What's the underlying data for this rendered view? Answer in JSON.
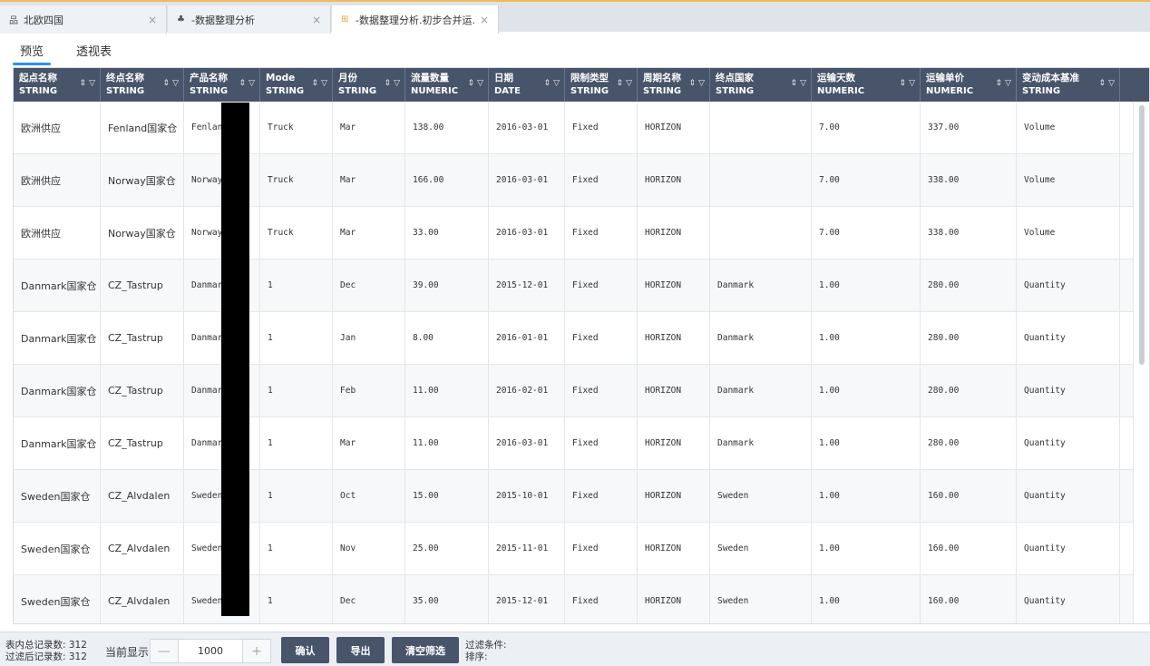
{
  "tabs": [
    {
      "icon": "hierarchy-icon",
      "glyph": "品",
      "label": "北欧四国",
      "close": "×"
    },
    {
      "icon": "cluster-icon",
      "glyph": "♣",
      "label": "-数据整理分析",
      "close": "×"
    },
    {
      "icon": "table-icon",
      "glyph": "⊞",
      "label": "-数据整理分析.初步合并运...",
      "close": "×"
    }
  ],
  "subtabs": {
    "preview": "预览",
    "pivot": "透视表"
  },
  "columns": [
    {
      "name": "起点名称",
      "type": "STRING"
    },
    {
      "name": "终点名称",
      "type": "STRING"
    },
    {
      "name": "产品名称",
      "type": "STRING"
    },
    {
      "name": "Mode",
      "type": "STRING"
    },
    {
      "name": "月份",
      "type": "STRING"
    },
    {
      "name": "流量数量",
      "type": "NUMERIC"
    },
    {
      "name": "日期",
      "type": "DATE"
    },
    {
      "name": "限制类型",
      "type": "STRING"
    },
    {
      "name": "周期名称",
      "type": "STRING"
    },
    {
      "name": "终点国家",
      "type": "STRING"
    },
    {
      "name": "运输天数",
      "type": "NUMERIC"
    },
    {
      "name": "运输单价",
      "type": "NUMERIC"
    },
    {
      "name": "变动成本基准",
      "type": "STRING"
    }
  ],
  "header_icons": {
    "sort": "⇕",
    "filter": "▽"
  },
  "rows": [
    [
      "欧洲供应",
      "Fenland国家仓",
      "Fenland",
      "Truck",
      "Mar",
      "138.00",
      "2016-03-01",
      "Fixed",
      "HORIZON",
      "",
      "7.00",
      "337.00",
      "Volume"
    ],
    [
      "欧洲供应",
      "Norway国家仓",
      "Norway_",
      "Truck",
      "Mar",
      "166.00",
      "2016-03-01",
      "Fixed",
      "HORIZON",
      "",
      "7.00",
      "338.00",
      "Volume"
    ],
    [
      "欧洲供应",
      "Norway国家仓",
      "Norway_",
      "Truck",
      "Mar",
      "33.00",
      "2016-03-01",
      "Fixed",
      "HORIZON",
      "",
      "7.00",
      "338.00",
      "Volume"
    ],
    [
      "Danmark国家仓",
      "CZ_Tastrup",
      "Danmark",
      "1",
      "Dec",
      "39.00",
      "2015-12-01",
      "Fixed",
      "HORIZON",
      "Danmark",
      "1.00",
      "280.00",
      "Quantity"
    ],
    [
      "Danmark国家仓",
      "CZ_Tastrup",
      "Danmark",
      "1",
      "Jan",
      "8.00",
      "2016-01-01",
      "Fixed",
      "HORIZON",
      "Danmark",
      "1.00",
      "280.00",
      "Quantity"
    ],
    [
      "Danmark国家仓",
      "CZ_Tastrup",
      "Danmark",
      "1",
      "Feb",
      "11.00",
      "2016-02-01",
      "Fixed",
      "HORIZON",
      "Danmark",
      "1.00",
      "280.00",
      "Quantity"
    ],
    [
      "Danmark国家仓",
      "CZ_Tastrup",
      "Danmark",
      "1",
      "Mar",
      "11.00",
      "2016-03-01",
      "Fixed",
      "HORIZON",
      "Danmark",
      "1.00",
      "280.00",
      "Quantity"
    ],
    [
      "Sweden国家仓",
      "CZ_Alvdalen",
      "Sweden_",
      "1",
      "Oct",
      "15.00",
      "2015-10-01",
      "Fixed",
      "HORIZON",
      "Sweden",
      "1.00",
      "160.00",
      "Quantity"
    ],
    [
      "Sweden国家仓",
      "CZ_Alvdalen",
      "Sweden_",
      "1",
      "Nov",
      "25.00",
      "2015-11-01",
      "Fixed",
      "HORIZON",
      "Sweden",
      "1.00",
      "160.00",
      "Quantity"
    ],
    [
      "Sweden国家仓",
      "CZ_Alvdalen",
      "Sweden_",
      "1",
      "Dec",
      "35.00",
      "2015-12-01",
      "Fixed",
      "HORIZON",
      "Sweden",
      "1.00",
      "160.00",
      "Quantity"
    ]
  ],
  "footer": {
    "total_records": "表内总记录数: 312",
    "filtered_records": "过滤后记录数: 312",
    "current_display_label": "当前显示",
    "minus": "—",
    "display_count": "1000",
    "plus": "+",
    "confirm": "确认",
    "export": "导出",
    "clear_filter": "清空筛选",
    "filter_condition": "过滤条件:",
    "sort": "排序:"
  },
  "colors": {
    "header_bg": "#48546a",
    "accent": "#2f8ff0",
    "active_tab_icon": "#e8a33d"
  }
}
